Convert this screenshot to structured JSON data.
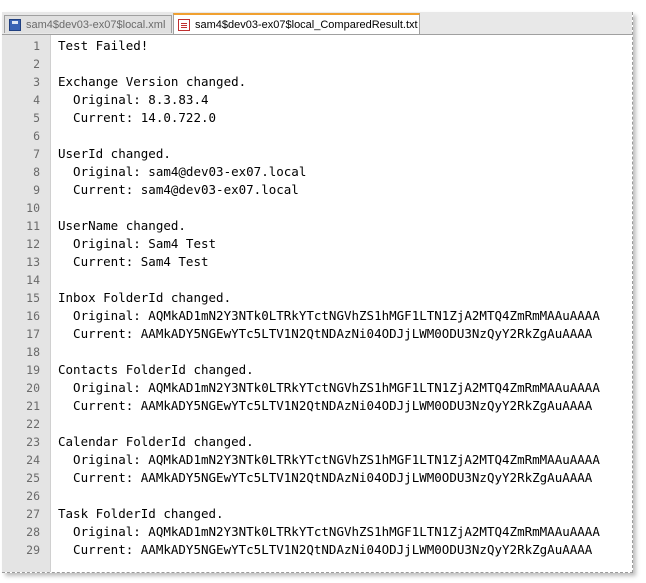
{
  "tabs": [
    {
      "label": "sam4$dev03-ex07$local.xml",
      "icon": "disk-icon",
      "active": false
    },
    {
      "label": "sam4$dev03-ex07$local_ComparedResult.txt",
      "icon": "text-file-icon",
      "active": true
    }
  ],
  "lines": [
    {
      "n": "1",
      "text": "Test Failed!"
    },
    {
      "n": "2",
      "text": ""
    },
    {
      "n": "3",
      "text": "Exchange Version changed."
    },
    {
      "n": "4",
      "text": "  Original: 8.3.83.4"
    },
    {
      "n": "5",
      "text": "  Current: 14.0.722.0"
    },
    {
      "n": "6",
      "text": ""
    },
    {
      "n": "7",
      "text": "UserId changed."
    },
    {
      "n": "8",
      "text": "  Original: sam4@dev03-ex07.local"
    },
    {
      "n": "9",
      "text": "  Current: sam4@dev03-ex07.local"
    },
    {
      "n": "10",
      "text": ""
    },
    {
      "n": "11",
      "text": "UserName changed."
    },
    {
      "n": "12",
      "text": "  Original: Sam4 Test"
    },
    {
      "n": "13",
      "text": "  Current: Sam4 Test"
    },
    {
      "n": "14",
      "text": ""
    },
    {
      "n": "15",
      "text": "Inbox FolderId changed."
    },
    {
      "n": "16",
      "text": "  Original: AQMkAD1mN2Y3NTk0LTRkYTctNGVhZS1hMGF1LTN1ZjA2MTQ4ZmRmMAAuAAAA"
    },
    {
      "n": "17",
      "text": "  Current: AAMkADY5NGEwYTc5LTV1N2QtNDAzNi04ODJjLWM0ODU3NzQyY2RkZgAuAAAA"
    },
    {
      "n": "18",
      "text": ""
    },
    {
      "n": "19",
      "text": "Contacts FolderId changed."
    },
    {
      "n": "20",
      "text": "  Original: AQMkAD1mN2Y3NTk0LTRkYTctNGVhZS1hMGF1LTN1ZjA2MTQ4ZmRmMAAuAAAA"
    },
    {
      "n": "21",
      "text": "  Current: AAMkADY5NGEwYTc5LTV1N2QtNDAzNi04ODJjLWM0ODU3NzQyY2RkZgAuAAAA"
    },
    {
      "n": "22",
      "text": ""
    },
    {
      "n": "23",
      "text": "Calendar FolderId changed."
    },
    {
      "n": "24",
      "text": "  Original: AQMkAD1mN2Y3NTk0LTRkYTctNGVhZS1hMGF1LTN1ZjA2MTQ4ZmRmMAAuAAAA"
    },
    {
      "n": "25",
      "text": "  Current: AAMkADY5NGEwYTc5LTV1N2QtNDAzNi04ODJjLWM0ODU3NzQyY2RkZgAuAAAA"
    },
    {
      "n": "26",
      "text": ""
    },
    {
      "n": "27",
      "text": "Task FolderId changed."
    },
    {
      "n": "28",
      "text": "  Original: AQMkAD1mN2Y3NTk0LTRkYTctNGVhZS1hMGF1LTN1ZjA2MTQ4ZmRmMAAuAAAA"
    },
    {
      "n": "29",
      "text": "  Current: AAMkADY5NGEwYTc5LTV1N2QtNDAzNi04ODJjLWM0ODU3NzQyY2RkZgAuAAAA"
    }
  ]
}
